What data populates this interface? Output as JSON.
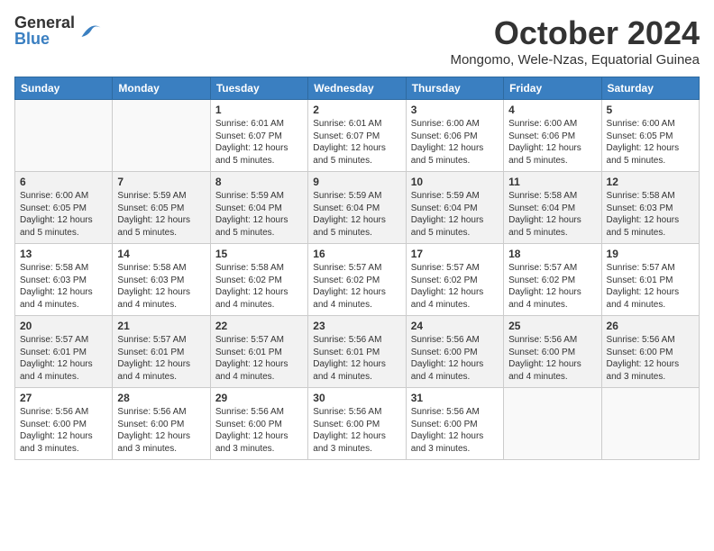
{
  "header": {
    "logo_general": "General",
    "logo_blue": "Blue",
    "month": "October 2024",
    "location": "Mongomo, Wele-Nzas, Equatorial Guinea"
  },
  "days_of_week": [
    "Sunday",
    "Monday",
    "Tuesday",
    "Wednesday",
    "Thursday",
    "Friday",
    "Saturday"
  ],
  "weeks": [
    {
      "days": [
        {
          "num": "",
          "empty": true
        },
        {
          "num": "",
          "empty": true
        },
        {
          "num": "1",
          "sunrise": "Sunrise: 6:01 AM",
          "sunset": "Sunset: 6:07 PM",
          "daylight": "Daylight: 12 hours and 5 minutes."
        },
        {
          "num": "2",
          "sunrise": "Sunrise: 6:01 AM",
          "sunset": "Sunset: 6:07 PM",
          "daylight": "Daylight: 12 hours and 5 minutes."
        },
        {
          "num": "3",
          "sunrise": "Sunrise: 6:00 AM",
          "sunset": "Sunset: 6:06 PM",
          "daylight": "Daylight: 12 hours and 5 minutes."
        },
        {
          "num": "4",
          "sunrise": "Sunrise: 6:00 AM",
          "sunset": "Sunset: 6:06 PM",
          "daylight": "Daylight: 12 hours and 5 minutes."
        },
        {
          "num": "5",
          "sunrise": "Sunrise: 6:00 AM",
          "sunset": "Sunset: 6:05 PM",
          "daylight": "Daylight: 12 hours and 5 minutes."
        }
      ]
    },
    {
      "days": [
        {
          "num": "6",
          "sunrise": "Sunrise: 6:00 AM",
          "sunset": "Sunset: 6:05 PM",
          "daylight": "Daylight: 12 hours and 5 minutes."
        },
        {
          "num": "7",
          "sunrise": "Sunrise: 5:59 AM",
          "sunset": "Sunset: 6:05 PM",
          "daylight": "Daylight: 12 hours and 5 minutes."
        },
        {
          "num": "8",
          "sunrise": "Sunrise: 5:59 AM",
          "sunset": "Sunset: 6:04 PM",
          "daylight": "Daylight: 12 hours and 5 minutes."
        },
        {
          "num": "9",
          "sunrise": "Sunrise: 5:59 AM",
          "sunset": "Sunset: 6:04 PM",
          "daylight": "Daylight: 12 hours and 5 minutes."
        },
        {
          "num": "10",
          "sunrise": "Sunrise: 5:59 AM",
          "sunset": "Sunset: 6:04 PM",
          "daylight": "Daylight: 12 hours and 5 minutes."
        },
        {
          "num": "11",
          "sunrise": "Sunrise: 5:58 AM",
          "sunset": "Sunset: 6:04 PM",
          "daylight": "Daylight: 12 hours and 5 minutes."
        },
        {
          "num": "12",
          "sunrise": "Sunrise: 5:58 AM",
          "sunset": "Sunset: 6:03 PM",
          "daylight": "Daylight: 12 hours and 5 minutes."
        }
      ]
    },
    {
      "days": [
        {
          "num": "13",
          "sunrise": "Sunrise: 5:58 AM",
          "sunset": "Sunset: 6:03 PM",
          "daylight": "Daylight: 12 hours and 4 minutes."
        },
        {
          "num": "14",
          "sunrise": "Sunrise: 5:58 AM",
          "sunset": "Sunset: 6:03 PM",
          "daylight": "Daylight: 12 hours and 4 minutes."
        },
        {
          "num": "15",
          "sunrise": "Sunrise: 5:58 AM",
          "sunset": "Sunset: 6:02 PM",
          "daylight": "Daylight: 12 hours and 4 minutes."
        },
        {
          "num": "16",
          "sunrise": "Sunrise: 5:57 AM",
          "sunset": "Sunset: 6:02 PM",
          "daylight": "Daylight: 12 hours and 4 minutes."
        },
        {
          "num": "17",
          "sunrise": "Sunrise: 5:57 AM",
          "sunset": "Sunset: 6:02 PM",
          "daylight": "Daylight: 12 hours and 4 minutes."
        },
        {
          "num": "18",
          "sunrise": "Sunrise: 5:57 AM",
          "sunset": "Sunset: 6:02 PM",
          "daylight": "Daylight: 12 hours and 4 minutes."
        },
        {
          "num": "19",
          "sunrise": "Sunrise: 5:57 AM",
          "sunset": "Sunset: 6:01 PM",
          "daylight": "Daylight: 12 hours and 4 minutes."
        }
      ]
    },
    {
      "days": [
        {
          "num": "20",
          "sunrise": "Sunrise: 5:57 AM",
          "sunset": "Sunset: 6:01 PM",
          "daylight": "Daylight: 12 hours and 4 minutes."
        },
        {
          "num": "21",
          "sunrise": "Sunrise: 5:57 AM",
          "sunset": "Sunset: 6:01 PM",
          "daylight": "Daylight: 12 hours and 4 minutes."
        },
        {
          "num": "22",
          "sunrise": "Sunrise: 5:57 AM",
          "sunset": "Sunset: 6:01 PM",
          "daylight": "Daylight: 12 hours and 4 minutes."
        },
        {
          "num": "23",
          "sunrise": "Sunrise: 5:56 AM",
          "sunset": "Sunset: 6:01 PM",
          "daylight": "Daylight: 12 hours and 4 minutes."
        },
        {
          "num": "24",
          "sunrise": "Sunrise: 5:56 AM",
          "sunset": "Sunset: 6:00 PM",
          "daylight": "Daylight: 12 hours and 4 minutes."
        },
        {
          "num": "25",
          "sunrise": "Sunrise: 5:56 AM",
          "sunset": "Sunset: 6:00 PM",
          "daylight": "Daylight: 12 hours and 4 minutes."
        },
        {
          "num": "26",
          "sunrise": "Sunrise: 5:56 AM",
          "sunset": "Sunset: 6:00 PM",
          "daylight": "Daylight: 12 hours and 3 minutes."
        }
      ]
    },
    {
      "days": [
        {
          "num": "27",
          "sunrise": "Sunrise: 5:56 AM",
          "sunset": "Sunset: 6:00 PM",
          "daylight": "Daylight: 12 hours and 3 minutes."
        },
        {
          "num": "28",
          "sunrise": "Sunrise: 5:56 AM",
          "sunset": "Sunset: 6:00 PM",
          "daylight": "Daylight: 12 hours and 3 minutes."
        },
        {
          "num": "29",
          "sunrise": "Sunrise: 5:56 AM",
          "sunset": "Sunset: 6:00 PM",
          "daylight": "Daylight: 12 hours and 3 minutes."
        },
        {
          "num": "30",
          "sunrise": "Sunrise: 5:56 AM",
          "sunset": "Sunset: 6:00 PM",
          "daylight": "Daylight: 12 hours and 3 minutes."
        },
        {
          "num": "31",
          "sunrise": "Sunrise: 5:56 AM",
          "sunset": "Sunset: 6:00 PM",
          "daylight": "Daylight: 12 hours and 3 minutes."
        },
        {
          "num": "",
          "empty": true
        },
        {
          "num": "",
          "empty": true
        }
      ]
    }
  ]
}
